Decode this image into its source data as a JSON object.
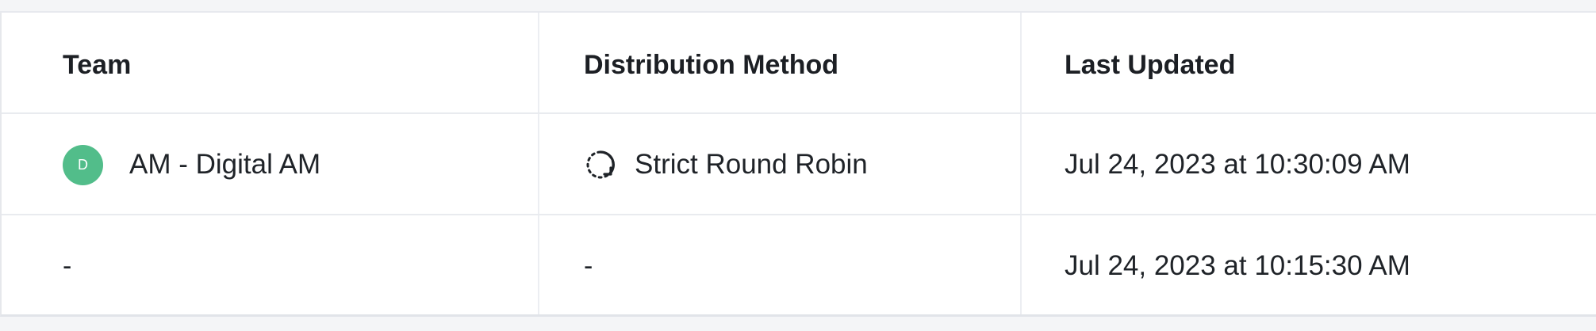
{
  "table": {
    "columns": [
      "Team",
      "Distribution Method",
      "Last Updated"
    ],
    "rows": [
      {
        "avatar_letter": "D",
        "team": "AM - Digital AM",
        "method": "Strict Round Robin",
        "method_icon": "round-robin-icon",
        "last_updated": "Jul 24, 2023 at 10:30:09 AM"
      },
      {
        "team": "-",
        "method": "-",
        "last_updated": "Jul 24, 2023 at 10:15:30 AM"
      }
    ]
  },
  "colors": {
    "avatar_bg": "#52bd8a",
    "border": "#e9ebef",
    "text": "#1f2328"
  }
}
